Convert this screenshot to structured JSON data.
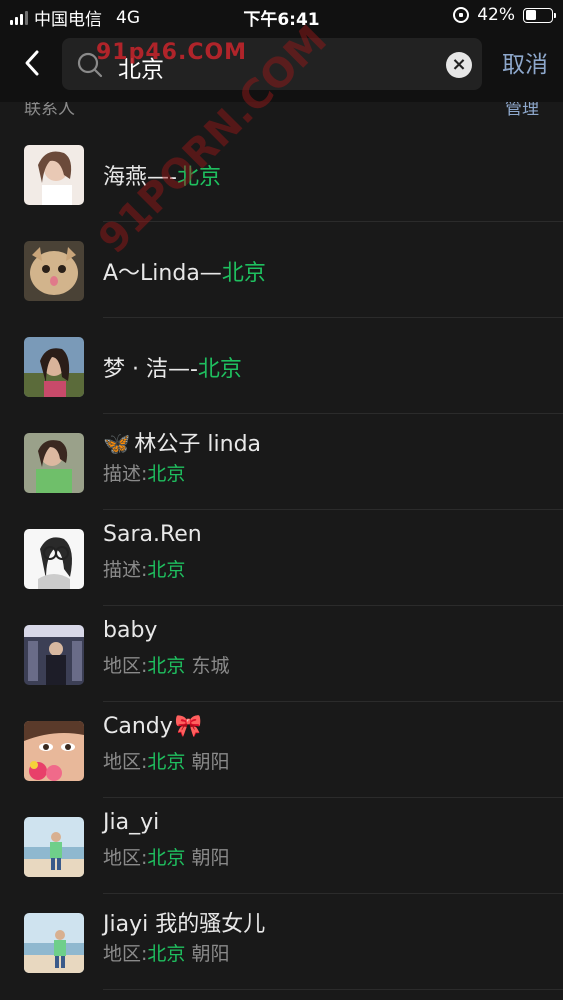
{
  "status_bar": {
    "carrier": "中国电信",
    "network": "4G",
    "time": "下午6:41",
    "battery": "42%",
    "battery_level": 0.42
  },
  "search": {
    "query": "北京",
    "cancel_label": "取消"
  },
  "section": {
    "title": "联系人",
    "more_label": "管理"
  },
  "contacts": [
    {
      "name_prefix": "海燕—-",
      "name_highlight": "北京",
      "name_suffix": "",
      "sub_prefix": "",
      "sub_highlight": "",
      "sub_suffix": "",
      "avatar": "woman-selfie-avatar"
    },
    {
      "name_prefix": "A～Linda—",
      "name_highlight": "北京",
      "name_suffix": "",
      "sub_prefix": "",
      "sub_highlight": "",
      "sub_suffix": "",
      "avatar": "cat-avatar"
    },
    {
      "name_prefix": "梦 · 洁—-",
      "name_highlight": "北京",
      "name_suffix": "",
      "sub_prefix": "",
      "sub_highlight": "",
      "sub_suffix": "",
      "avatar": "woman-outdoor-avatar"
    },
    {
      "name_prefix": "林公子 linda",
      "name_highlight": "",
      "name_suffix": "",
      "sub_prefix": "描述:",
      "sub_highlight": "北京",
      "sub_suffix": "",
      "avatar": "woman-green-top-avatar"
    },
    {
      "name_prefix": "Sara.Ren",
      "name_highlight": "",
      "name_suffix": "",
      "sub_prefix": "描述:",
      "sub_highlight": "北京",
      "sub_suffix": "",
      "avatar": "sketch-girl-avatar"
    },
    {
      "name_prefix": "baby",
      "name_highlight": "",
      "name_suffix": "",
      "sub_prefix": "地区:",
      "sub_highlight": "北京",
      "sub_suffix": " 东城",
      "avatar": "woman-street-avatar"
    },
    {
      "name_prefix": "Candy",
      "name_highlight": "",
      "name_suffix": "",
      "sub_prefix": "地区:",
      "sub_highlight": "北京",
      "sub_suffix": " 朝阳",
      "avatar": "woman-flower-avatar"
    },
    {
      "name_prefix": "Jia_yi",
      "name_highlight": "",
      "name_suffix": "",
      "sub_prefix": "地区:",
      "sub_highlight": "北京",
      "sub_suffix": " 朝阳",
      "avatar": "beach-avatar"
    },
    {
      "name_prefix": "Jiayi 我的骚女儿",
      "name_highlight": "",
      "name_suffix": "",
      "sub_prefix": "地区:",
      "sub_highlight": "北京",
      "sub_suffix": " 朝阳",
      "avatar": "beach-avatar-2"
    }
  ],
  "watermark": {
    "top": "91p46.COM",
    "diagonal": "91PORN.COM"
  },
  "colors": {
    "background": "#191919",
    "highlight": "#1fbf5f",
    "link": "#8ea8cc",
    "secondary_text": "#8a8a8a"
  }
}
